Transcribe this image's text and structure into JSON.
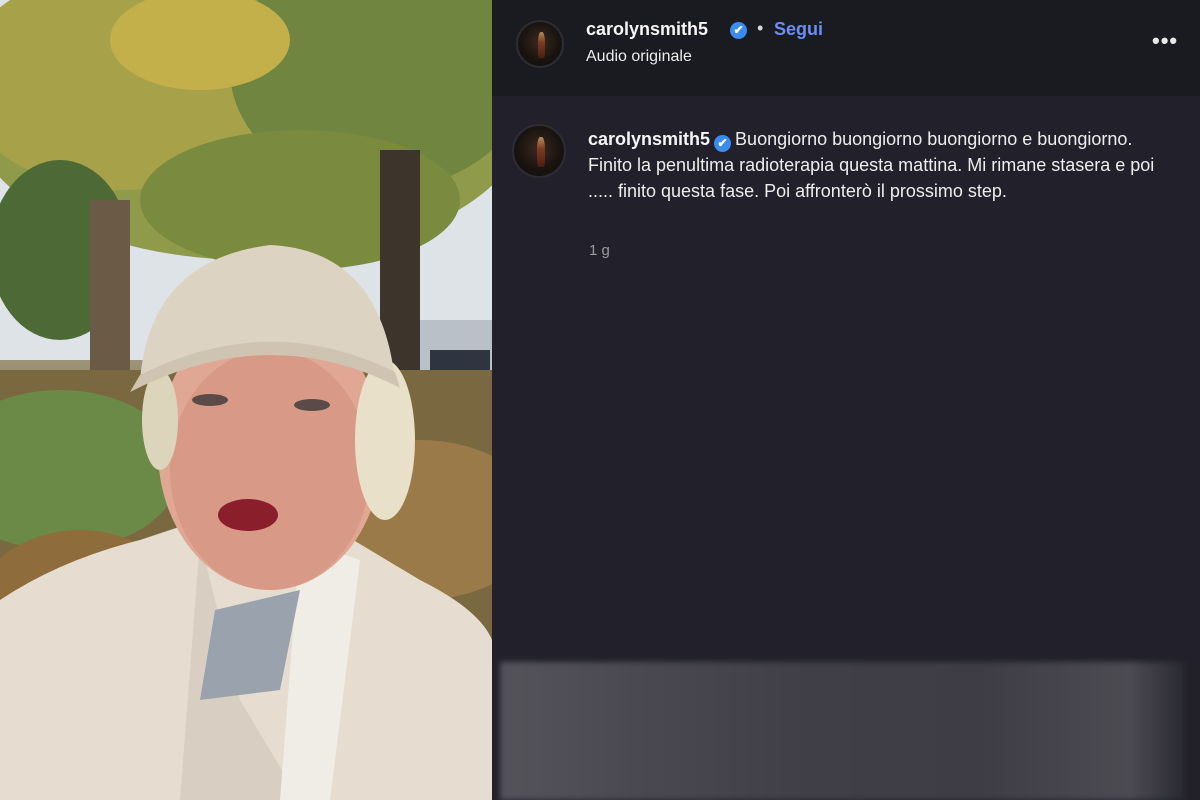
{
  "header": {
    "username": "carolynsmith5",
    "verified_icon": "✔",
    "separator": "•",
    "follow_label": "Segui",
    "audio_label": "Audio originale",
    "more_label": "•••"
  },
  "comment": {
    "username": "carolynsmith5",
    "verified_icon": "✔",
    "text": "Buongiorno buongiorno buongiorno e buongiorno. Finito la penultima radioterapia questa mattina. Mi rimane stasera e poi ..... finito questa fase. Poi affronterò il prossimo step.",
    "time": "1 g"
  },
  "colors": {
    "panel_bg": "#22212b",
    "header_bg": "#1a1a21",
    "accent_follow": "#6a8ef5",
    "verified": "#3b8cf0"
  }
}
